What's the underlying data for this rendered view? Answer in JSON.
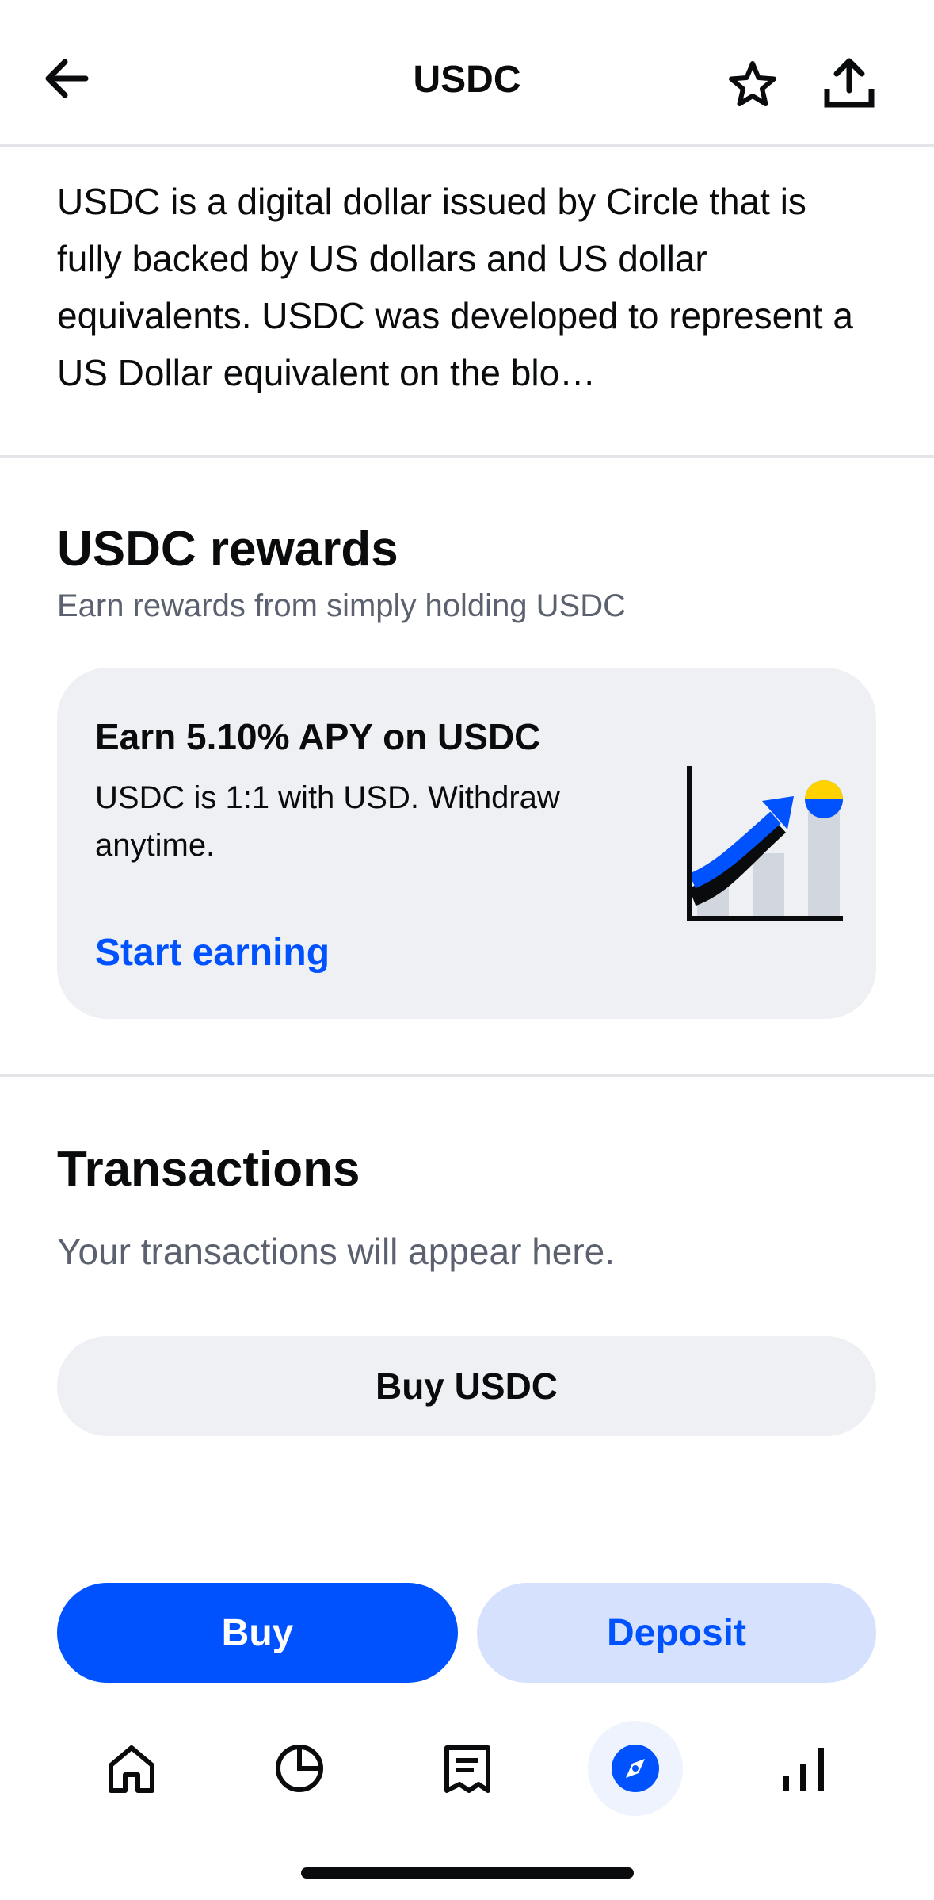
{
  "header": {
    "title": "USDC",
    "back_icon": "arrow-left-icon",
    "star_icon": "star-outline-icon",
    "share_icon": "share-upload-icon"
  },
  "about": {
    "description": "USDC is a digital dollar issued by Circle that is fully backed by US dollars and US dollar equivalents. USDC was developed to represent a US Dollar equivalent on the blo…"
  },
  "rewards": {
    "title": "USDC rewards",
    "subtitle": "Earn rewards from simply holding USDC",
    "card": {
      "title": "Earn 5.10% APY on USDC",
      "body": "USDC is 1:1 with USD. Withdraw anytime.",
      "link": "Start earning",
      "illustration_icon": "growth-chart-icon"
    }
  },
  "transactions": {
    "title": "Transactions",
    "empty_text": "Your transactions will appear here.",
    "buy_button": "Buy USDC"
  },
  "actions": {
    "buy": "Buy",
    "deposit": "Deposit"
  },
  "nav": {
    "items": [
      {
        "icon": "home-icon"
      },
      {
        "icon": "portfolio-pie-icon"
      },
      {
        "icon": "transactions-receipt-icon"
      },
      {
        "icon": "explore-compass-icon",
        "active": true
      },
      {
        "icon": "markets-bars-icon"
      }
    ]
  },
  "colors": {
    "brand_blue": "#0052ff",
    "light_blue": "#d6e2fd",
    "card_gray": "#eef0f3",
    "text_secondary": "#5b616e"
  }
}
